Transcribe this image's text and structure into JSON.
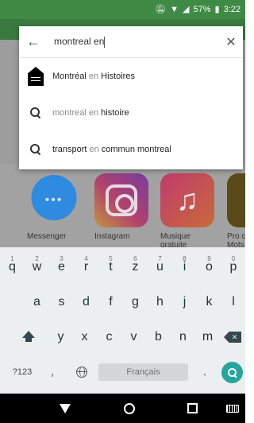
{
  "status_bar": {
    "battery_percent": "57%",
    "time": "3:22",
    "icons": [
      "mute-icon",
      "wifi-icon",
      "signal-icon",
      "battery-icon"
    ]
  },
  "search": {
    "query": "montreal en",
    "back_icon": "arrow-left-icon",
    "clear_icon": "close-icon"
  },
  "suggestions": [
    {
      "icon": "app-icon",
      "prefix": "Montréal",
      "muted": " en ",
      "suffix": "Histoires"
    },
    {
      "icon": "search-icon",
      "prefix": "",
      "muted": "montreal en ",
      "suffix": "histoire"
    },
    {
      "icon": "search-icon",
      "prefix": "transport",
      "muted": " en ",
      "suffix": "commun montreal"
    }
  ],
  "background_apps": [
    {
      "label": "Messenger"
    },
    {
      "label": "Instagram"
    },
    {
      "label": "Musique gratuite"
    },
    {
      "label": "Pro c Mots"
    }
  ],
  "keyboard": {
    "row1": [
      {
        "key": "q",
        "hint": "1"
      },
      {
        "key": "w",
        "hint": "2"
      },
      {
        "key": "e",
        "hint": "3"
      },
      {
        "key": "r",
        "hint": "4"
      },
      {
        "key": "t",
        "hint": "5"
      },
      {
        "key": "z",
        "hint": "6"
      },
      {
        "key": "u",
        "hint": "7"
      },
      {
        "key": "i",
        "hint": "8"
      },
      {
        "key": "o",
        "hint": "9"
      },
      {
        "key": "p",
        "hint": "0"
      }
    ],
    "row2": [
      "a",
      "s",
      "d",
      "f",
      "g",
      "h",
      "j",
      "k",
      "l"
    ],
    "row3": [
      "y",
      "x",
      "c",
      "v",
      "b",
      "n",
      "m"
    ],
    "symbols_label": "?123",
    "comma": ",",
    "space_label": "Français",
    "period": "."
  },
  "nav_bar": {
    "icons": [
      "back-nav-icon",
      "home-nav-icon",
      "recents-nav-icon",
      "keyboard-switch-icon"
    ]
  },
  "colors": {
    "status_bar_bg": "#3f8a45",
    "keyboard_bg": "#eceff1",
    "enter_key": "#26a69a"
  }
}
